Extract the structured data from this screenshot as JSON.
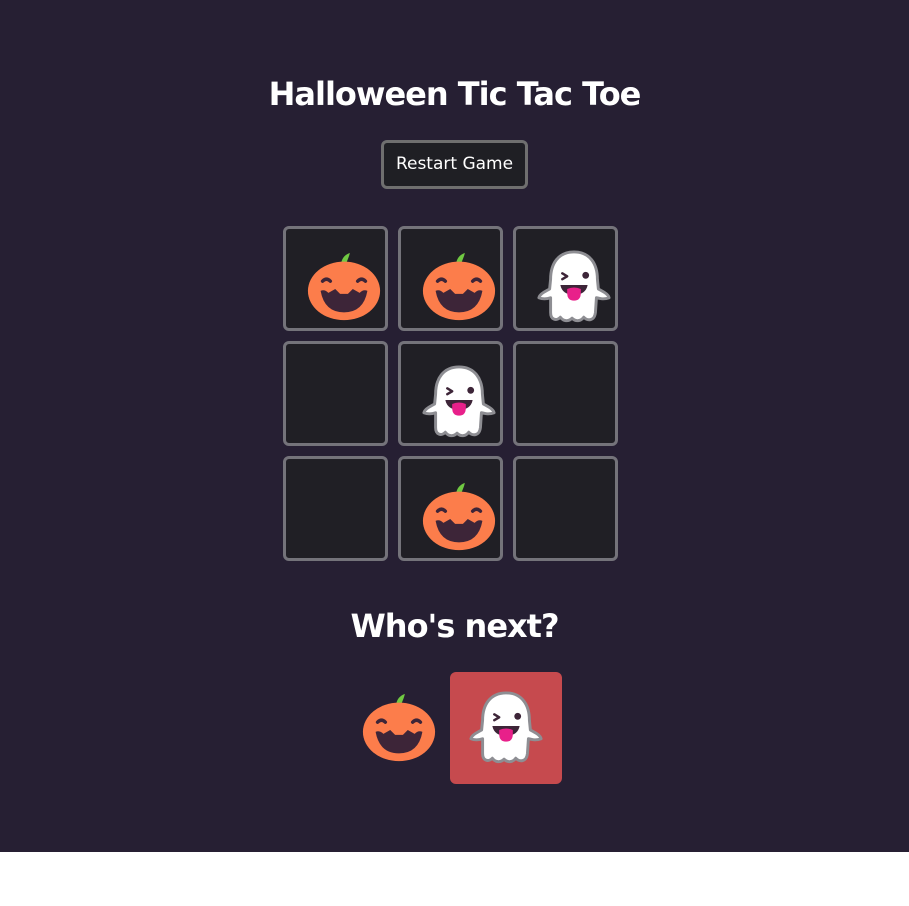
{
  "app": {
    "title": "Halloween Tic Tac Toe",
    "restart_label": "Restart Game"
  },
  "board": {
    "cells": [
      "pumpkin",
      "pumpkin",
      "ghost",
      "",
      "ghost",
      "",
      "",
      "pumpkin",
      ""
    ]
  },
  "turn": {
    "heading": "Who's next?",
    "players": [
      {
        "icon": "pumpkin-icon",
        "active": false
      },
      {
        "icon": "ghost-icon",
        "active": true
      }
    ]
  },
  "colors": {
    "background": "#261f33",
    "cell_background": "#201f25",
    "cell_border": "#74737a",
    "pumpkin": "#fc7d4b",
    "pumpkin_face": "#3d2538",
    "stem": "#70c942",
    "ghost": "#ffffff",
    "ghost_outline": "#8e8e93",
    "tongue": "#e8208a",
    "active_highlight": "#c64a4e"
  }
}
